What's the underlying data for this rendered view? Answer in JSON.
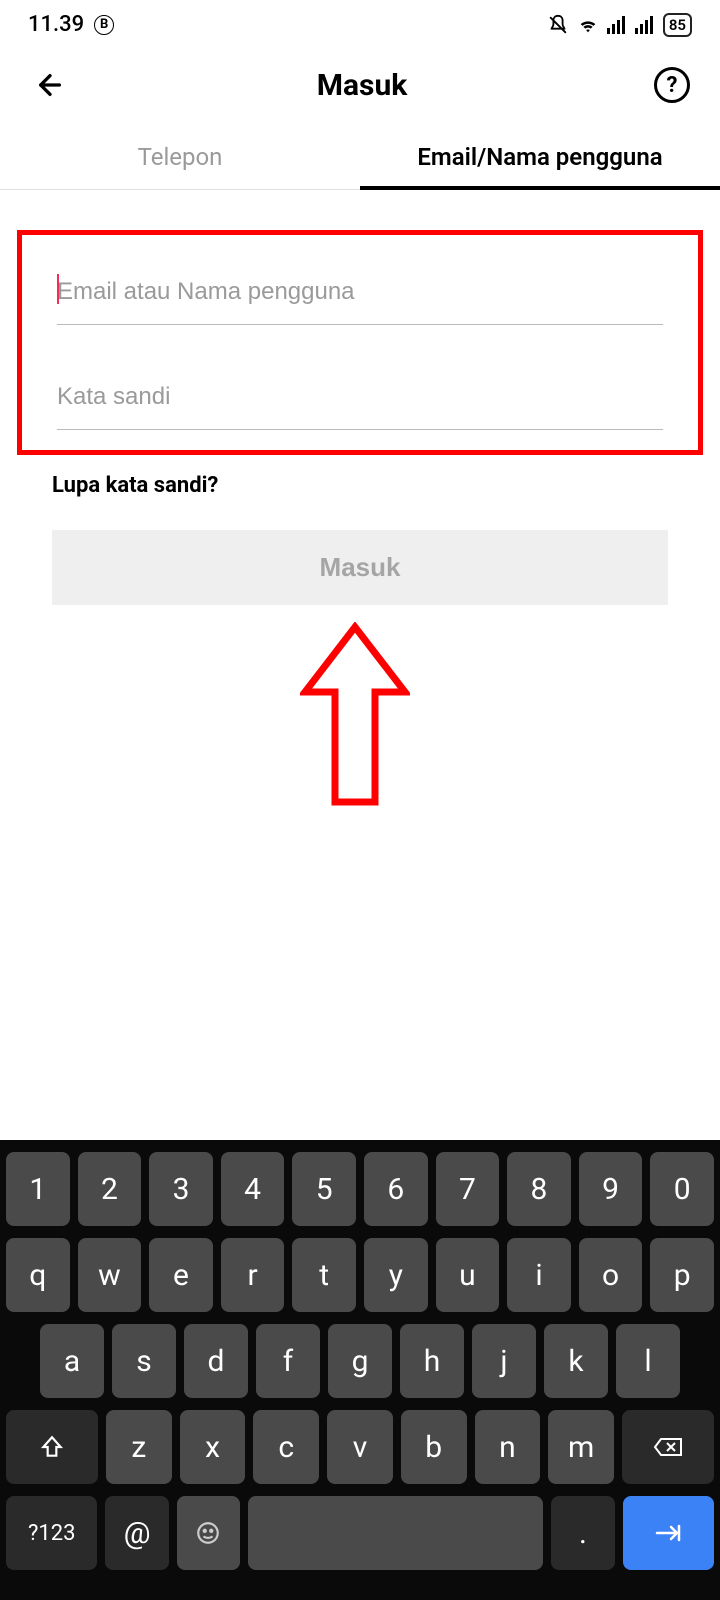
{
  "status": {
    "time": "11.39",
    "battery": "85"
  },
  "header": {
    "title": "Masuk"
  },
  "tabs": {
    "phone": "Telepon",
    "email": "Email/Nama pengguna"
  },
  "form": {
    "email_placeholder": "Email atau Nama pengguna",
    "password_placeholder": "Kata sandi",
    "forgot": "Lupa kata sandi?",
    "login_button": "Masuk"
  },
  "keyboard": {
    "row1": [
      "1",
      "2",
      "3",
      "4",
      "5",
      "6",
      "7",
      "8",
      "9",
      "0"
    ],
    "row2": [
      "q",
      "w",
      "e",
      "r",
      "t",
      "y",
      "u",
      "i",
      "o",
      "p"
    ],
    "row3": [
      "a",
      "s",
      "d",
      "f",
      "g",
      "h",
      "j",
      "k",
      "l"
    ],
    "row4": [
      "z",
      "x",
      "c",
      "v",
      "b",
      "n",
      "m"
    ],
    "fn": "?123",
    "at": "@",
    "dot": "."
  }
}
